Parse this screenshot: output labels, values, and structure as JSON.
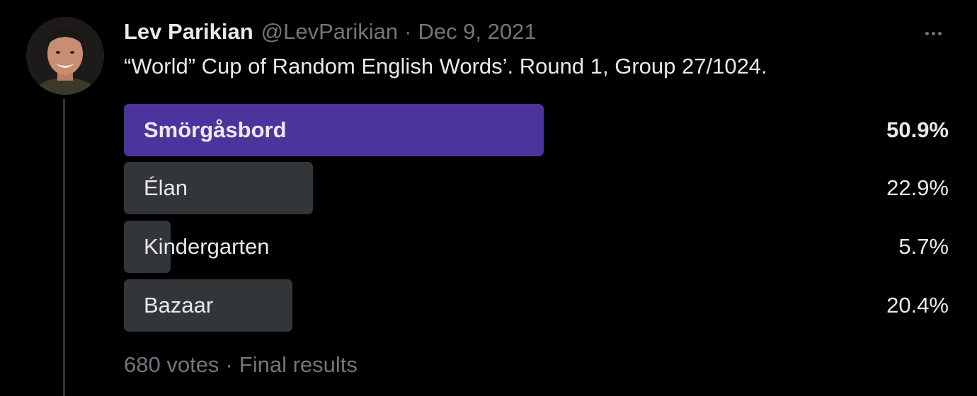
{
  "tweet": {
    "author_name": "Lev Parikian",
    "author_handle": "@LevParikian",
    "separator": "·",
    "date": "Dec 9, 2021",
    "text": "“World” Cup of Random English Words’. Round 1, Group 27/1024.",
    "more_icon": "more-horizontal-icon"
  },
  "poll": {
    "options": [
      {
        "label": "Smörgåsbord",
        "percent_text": "50.9%",
        "percent": 50.9,
        "winner": true
      },
      {
        "label": "Élan",
        "percent_text": "22.9%",
        "percent": 22.9,
        "winner": false
      },
      {
        "label": "Kindergarten",
        "percent_text": "5.7%",
        "percent": 5.7,
        "winner": false
      },
      {
        "label": "Bazaar",
        "percent_text": "20.4%",
        "percent": 20.4,
        "winner": false
      }
    ],
    "votes": "680 votes",
    "separator": "·",
    "status": "Final results"
  },
  "colors": {
    "background": "#000000",
    "winner_bar": "#4b359c",
    "bar": "#333639",
    "text_primary": "#e7e9ea",
    "text_secondary": "#71767b"
  }
}
